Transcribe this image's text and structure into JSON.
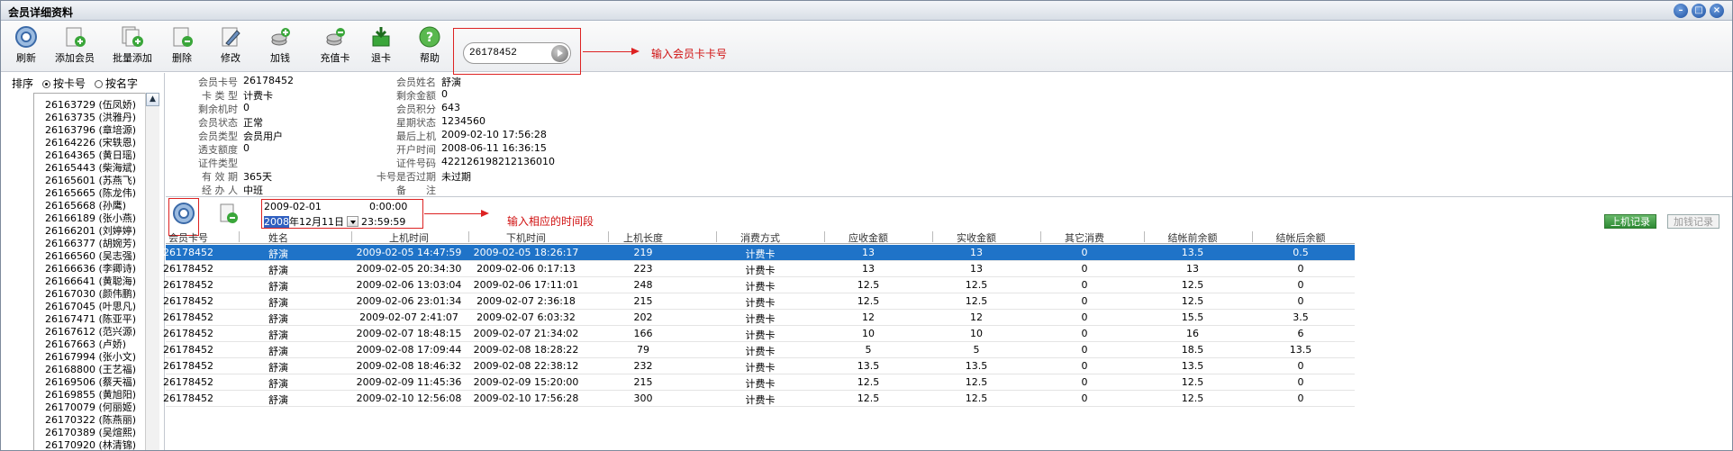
{
  "window": {
    "title": "会员详细资料"
  },
  "toolbar": {
    "buttons": [
      {
        "label": "刷新",
        "icon": "refresh-icon"
      },
      {
        "label": "添加会员",
        "icon": "add-member-icon"
      },
      {
        "label": "批量添加",
        "icon": "batch-add-icon"
      },
      {
        "label": "删除",
        "icon": "delete-icon"
      },
      {
        "label": "修改",
        "icon": "edit-icon"
      },
      {
        "label": "加钱",
        "icon": "add-money-icon"
      },
      {
        "label": "充值卡",
        "icon": "recharge-card-icon"
      },
      {
        "label": "退卡",
        "icon": "return-card-icon"
      },
      {
        "label": "帮助",
        "icon": "help-icon"
      }
    ],
    "search_value": "26178452",
    "search_note": "输入会员卡卡号"
  },
  "sidebar": {
    "sort_label": "排序",
    "sort_by_card": "按卡号",
    "sort_by_name": "按名字",
    "items": [
      "26163729 (伍凤娇)",
      "26163735 (洪雅丹)",
      "26163796 (章培源)",
      "26164226 (宋轶恩)",
      "26164365 (黄日瑶)",
      "26165443 (柴海斌)",
      "26165601 (苏燕飞)",
      "26165665 (陈龙伟)",
      "26165668 (孙鹰)",
      "26166189 (张小燕)",
      "26166201 (刘婷婷)",
      "26166377 (胡婉芳)",
      "26166560 (吴志强)",
      "26166636 (李卿诗)",
      "26166641 (黄聪海)",
      "26167030 (颜伟鹏)",
      "26167045 (叶思凡)",
      "26167471 (陈亚平)",
      "26167612 (范兴源)",
      "26167663 (卢娇)",
      "26167994 (张小文)",
      "26168800 (王艺福)",
      "26169506 (蔡天福)",
      "26169855 (黄旭阳)",
      "26170079 (何丽姬)",
      "26170322 (陈燕丽)",
      "26170389 (吴煊熙)",
      "26170920 (林清锦)"
    ]
  },
  "member": {
    "left": [
      {
        "label": "会员卡号",
        "value": "26178452"
      },
      {
        "label": "卡 类 型",
        "value": "计费卡"
      },
      {
        "label": "剩余机时",
        "value": "0"
      },
      {
        "label": "会员状态",
        "value": "正常"
      },
      {
        "label": "会员类型",
        "value": "会员用户"
      },
      {
        "label": "透支额度",
        "value": "0"
      },
      {
        "label": "证件类型",
        "value": ""
      },
      {
        "label": "有 效 期",
        "value": "365天"
      },
      {
        "label": "经 办 人",
        "value": "中班"
      }
    ],
    "right": [
      {
        "label": "会员姓名",
        "value": "舒演"
      },
      {
        "label": "剩余金额",
        "value": "0"
      },
      {
        "label": "会员积分",
        "value": "643"
      },
      {
        "label": "星期状态",
        "value": "1234560"
      },
      {
        "label": "最后上机",
        "value": "2009-02-10 17:56:28"
      },
      {
        "label": "开户时间",
        "value": "2008-06-11 16:36:15"
      },
      {
        "label": "证件号码",
        "value": "422126198212136010"
      },
      {
        "label": "卡号是否过期",
        "value": "未过期"
      },
      {
        "label": "备　　注",
        "value": ""
      }
    ]
  },
  "query": {
    "start_date": "2009-02-01",
    "start_time": "0:00:00",
    "end_date_sel": "2008",
    "end_date_rest": "年12月11日",
    "end_time": "23:59:59",
    "note": "输入相应的时间段",
    "tab_online": "上机记录",
    "tab_addmoney": "加钱记录"
  },
  "table": {
    "columns": [
      "会员卡号",
      "姓名",
      "上机时间",
      "下机时间",
      "上机长度",
      "消费方式",
      "应收金额",
      "实收金额",
      "其它消费",
      "结帐前余额",
      "结帐后余额"
    ],
    "rows": [
      [
        "26178452",
        "舒演",
        "2009-02-05 14:47:59",
        "2009-02-05 18:26:17",
        "219",
        "计费卡",
        "13",
        "13",
        "0",
        "13.5",
        "0.5"
      ],
      [
        "26178452",
        "舒演",
        "2009-02-05 20:34:30",
        "2009-02-06 0:17:13",
        "223",
        "计费卡",
        "13",
        "13",
        "0",
        "13",
        "0"
      ],
      [
        "26178452",
        "舒演",
        "2009-02-06 13:03:04",
        "2009-02-06 17:11:01",
        "248",
        "计费卡",
        "12.5",
        "12.5",
        "0",
        "12.5",
        "0"
      ],
      [
        "26178452",
        "舒演",
        "2009-02-06 23:01:34",
        "2009-02-07 2:36:18",
        "215",
        "计费卡",
        "12.5",
        "12.5",
        "0",
        "12.5",
        "0"
      ],
      [
        "26178452",
        "舒演",
        "2009-02-07 2:41:07",
        "2009-02-07 6:03:32",
        "202",
        "计费卡",
        "12",
        "12",
        "0",
        "15.5",
        "3.5"
      ],
      [
        "26178452",
        "舒演",
        "2009-02-07 18:48:15",
        "2009-02-07 21:34:02",
        "166",
        "计费卡",
        "10",
        "10",
        "0",
        "16",
        "6"
      ],
      [
        "26178452",
        "舒演",
        "2009-02-08 17:09:44",
        "2009-02-08 18:28:22",
        "79",
        "计费卡",
        "5",
        "5",
        "0",
        "18.5",
        "13.5"
      ],
      [
        "26178452",
        "舒演",
        "2009-02-08 18:46:32",
        "2009-02-08 22:38:12",
        "232",
        "计费卡",
        "13.5",
        "13.5",
        "0",
        "13.5",
        "0"
      ],
      [
        "26178452",
        "舒演",
        "2009-02-09 11:45:36",
        "2009-02-09 15:20:00",
        "215",
        "计费卡",
        "12.5",
        "12.5",
        "0",
        "12.5",
        "0"
      ],
      [
        "26178452",
        "舒演",
        "2009-02-10 12:56:08",
        "2009-02-10 17:56:28",
        "300",
        "计费卡",
        "12.5",
        "12.5",
        "0",
        "12.5",
        "0"
      ]
    ]
  },
  "colors": {
    "selected_row": "#1f73c8",
    "annotation": "#d22222",
    "tab_active": "#2e8a33"
  }
}
